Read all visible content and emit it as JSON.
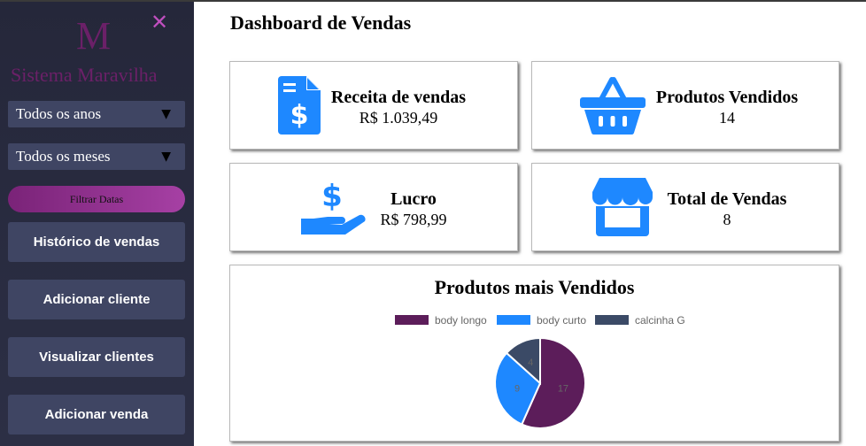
{
  "sidebar": {
    "logo_letter": "M",
    "brand": "Sistema Maravilha",
    "close_glyph": "✕",
    "year_select": {
      "value": "Todos os anos"
    },
    "month_select": {
      "value": "Todos os meses"
    },
    "filter_button": "Filtrar Datas",
    "nav": [
      {
        "label": "Histórico de vendas"
      },
      {
        "label": "Adicionar cliente"
      },
      {
        "label": "Visualizar clientes"
      },
      {
        "label": "Adicionar venda"
      }
    ]
  },
  "main": {
    "title": "Dashboard de Vendas",
    "cards": [
      {
        "label": "Receita de vendas",
        "value": "R$ 1.039,49",
        "icon": "invoice-dollar-icon"
      },
      {
        "label": "Produtos Vendidos",
        "value": "14",
        "icon": "shopping-basket-icon"
      },
      {
        "label": "Lucro",
        "value": "R$ 798,99",
        "icon": "hand-holding-dollar-icon"
      },
      {
        "label": "Total de Vendas",
        "value": "8",
        "icon": "store-icon"
      }
    ]
  },
  "colors": {
    "accent": "#1e88ff",
    "sidebar_bg": "#2a2c40",
    "button_bg": "#3f4563",
    "brand": "#6b2068"
  },
  "chart_data": {
    "type": "pie",
    "title": "Produtos mais Vendidos",
    "legend_position": "top",
    "series": [
      {
        "name": "body longo",
        "value": 17,
        "color": "#5c1d5a"
      },
      {
        "name": "body curto",
        "value": 9,
        "color": "#1e88ff"
      },
      {
        "name": "calcinha G",
        "value": 4,
        "color": "#3b4a66"
      }
    ]
  }
}
